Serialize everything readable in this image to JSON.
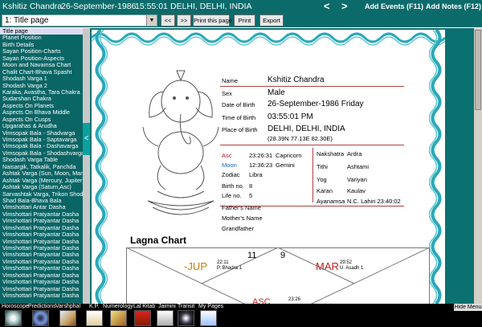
{
  "header": {
    "name": "Kshitiz Chandra",
    "date": "26-September-1986",
    "time": "15:55:01",
    "place": "DELHI, DELHI, INDIA",
    "prev": "<",
    "next": ">",
    "add_events": "Add Events (F11)",
    "add_notes": "Add Notes (F12)"
  },
  "toolbar": {
    "page_select": "1: Title page",
    "prev_btn": "<<",
    "next_btn": ">>",
    "print_page": "Print this page",
    "print": "Print",
    "export": "Export"
  },
  "sidebar": {
    "items": [
      "Title page",
      "Planet Position",
      "Birth Details",
      "Sayan Position-Charts",
      "Sayan Position-Aspects",
      "Moon and Navamsa Chart",
      "Chalit Chart-Bhava Spasht",
      "Shodash Varga 1",
      "Shodash Varga 2",
      "Karaka, Avastha, Tara Chakra",
      "Sudarshan Chakra",
      "Aspects On Planets",
      "Aspects On Bhava Middle",
      "Aspects On Cusps",
      "Upgarahas & Arudha",
      "Vimsopak Bala - Shadvarga",
      "Vimsopak Bala - Saptavarga",
      "Vimsopak Bala - Dashavarga",
      "Vimsopak Bala - Shodashvarga",
      "Shodash Varga Table",
      "Naisargik, Tatkalik, Panchda",
      "Ashtak Varga (Sun, Moon, Mars)",
      "Ashtak Varga (Mercury, Jupiter)",
      "Ashtak Varga (Saturn,Asc)",
      "Sarvashtak Varga, Trikon Shodhana",
      "Shad Bala-Bhava Bala",
      "Vimshottari Antar Dasha",
      "Vimshottari Pratyantar Dasha",
      "Vimshottari Pratyantar Dasha",
      "Vimshottari Pratyantar Dasha",
      "Vimshottari Pratyantar Dasha",
      "Vimshottari Pratyantar Dasha",
      "Vimshottari Pratyantar Dasha",
      "Vimshottari Pratyantar Dasha",
      "Vimshottari Pratyantar Dasha",
      "Vimshottari Pratyantar Dasha",
      "Vimshottari Pratyantar Dasha",
      "Vimshottari Pratyantar Dasha",
      "Vimshottari Pratyantar Dasha",
      "Vimshottari Pratyantar Dasha"
    ],
    "selected_index": 0,
    "collapse": "<"
  },
  "details": {
    "name_label": "Name",
    "name": "Kshitiz Chandra",
    "sex_label": "Sex",
    "sex": "Male",
    "dob_label": "Date of Birth",
    "dob": "26-September-1986 Friday",
    "tob_label": "Time of Birth",
    "tob": "03:55:01 PM",
    "pob_label": "Place of Birth",
    "pob": "DELHI, DELHI, INDIA",
    "coords": "(28.39N    77.13E    82.30E)"
  },
  "astro": {
    "asc_label": "Asc",
    "asc_deg": "23:26:31",
    "asc_sign": "Capricorn",
    "moon_label": "Moon",
    "moon_deg": "12:36:23",
    "moon_sign": "Gemini",
    "zodiac_label": "Zodiac",
    "zodiac": "Libra",
    "birthno_label": "Birth no.",
    "birthno": "8",
    "lifeno_label": "Life no.",
    "lifeno": "5",
    "nak_label": "Nakshatra",
    "nak": "Ardra",
    "tithi_label": "Tithi",
    "tithi": "Ashtami",
    "yog_label": "Yog",
    "yog": "Variyan",
    "karan_label": "Karan",
    "karan": "Kaulav",
    "ayan_label": "Ayanamsa",
    "ayan": "N.C. Lahiri 23:40:02"
  },
  "family": {
    "father": "Father's Name",
    "mother": "Mother's Name",
    "grandfather": "Grandfather"
  },
  "chart": {
    "title": "Lagna Chart",
    "h11": "11",
    "h9": "9",
    "jup": "-JUP",
    "jup_deg": "22:11",
    "jup_nak": "P. Bhadra 1",
    "mar": "MAR",
    "mar_deg": "29:52",
    "mar_nak": "U. Asadh 1",
    "asc_partial": "ASC",
    "asc_partial_deg": "23:26"
  },
  "bottom": {
    "labels": [
      "Horoscope",
      "Predictions",
      "Varshphal",
      "K.P.",
      "Numerology",
      "Lal Kitab",
      "Jaimini",
      "Transit",
      "My Pages"
    ],
    "hide_menu": "Hide Menu"
  },
  "colors": {
    "teal": "#0b6b6b",
    "red_text": "#c02020",
    "blue_text": "#2060c0",
    "jup_color": "#c08000"
  }
}
